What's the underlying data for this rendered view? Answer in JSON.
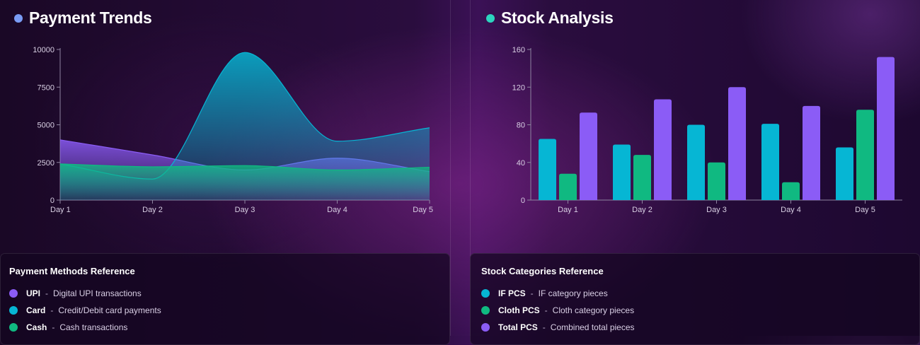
{
  "payment": {
    "title": "Payment Trends",
    "dot_color": "#7a9cf5",
    "reference_title": "Payment Methods Reference",
    "reference": [
      {
        "name": "UPI",
        "desc": "Digital UPI transactions",
        "color": "#8b5cf6"
      },
      {
        "name": "Card",
        "desc": "Credit/Debit card payments",
        "color": "#06b6d4"
      },
      {
        "name": "Cash",
        "desc": "Cash transactions",
        "color": "#10b981"
      }
    ]
  },
  "stock": {
    "title": "Stock Analysis",
    "dot_color": "#2dd4bf",
    "reference_title": "Stock Categories Reference",
    "reference": [
      {
        "name": "IF PCS",
        "desc": "IF category pieces",
        "color": "#06b6d4"
      },
      {
        "name": "Cloth PCS",
        "desc": "Cloth category pieces",
        "color": "#10b981"
      },
      {
        "name": "Total PCS",
        "desc": "Combined total pieces",
        "color": "#8b5cf6"
      }
    ]
  },
  "separator": "-",
  "chart_data": [
    {
      "type": "area",
      "title": "Payment Trends",
      "categories": [
        "Day 1",
        "Day 2",
        "Day 3",
        "Day 4",
        "Day 5"
      ],
      "ylim": [
        0,
        10000
      ],
      "yticks": [
        0,
        2500,
        5000,
        7500,
        10000
      ],
      "grid": false,
      "series": [
        {
          "name": "UPI",
          "color": "#8b5cf6",
          "values": [
            4000,
            3000,
            2000,
            2780,
            1890
          ]
        },
        {
          "name": "Card",
          "color": "#06b6d4",
          "values": [
            2400,
            1398,
            9800,
            3908,
            4800
          ]
        },
        {
          "name": "Cash",
          "color": "#10b981",
          "values": [
            2400,
            2210,
            2290,
            2000,
            2181
          ]
        }
      ]
    },
    {
      "type": "bar",
      "title": "Stock Analysis",
      "categories": [
        "Day 1",
        "Day 2",
        "Day 3",
        "Day 4",
        "Day 5"
      ],
      "ylim": [
        0,
        160
      ],
      "yticks": [
        0,
        40,
        80,
        120,
        160
      ],
      "grid": false,
      "series": [
        {
          "name": "IF PCS",
          "color": "#06b6d4",
          "values": [
            65,
            59,
            80,
            81,
            56
          ]
        },
        {
          "name": "Cloth PCS",
          "color": "#10b981",
          "values": [
            28,
            48,
            40,
            19,
            96
          ]
        },
        {
          "name": "Total PCS",
          "color": "#8b5cf6",
          "values": [
            93,
            107,
            120,
            100,
            152
          ]
        }
      ]
    }
  ]
}
